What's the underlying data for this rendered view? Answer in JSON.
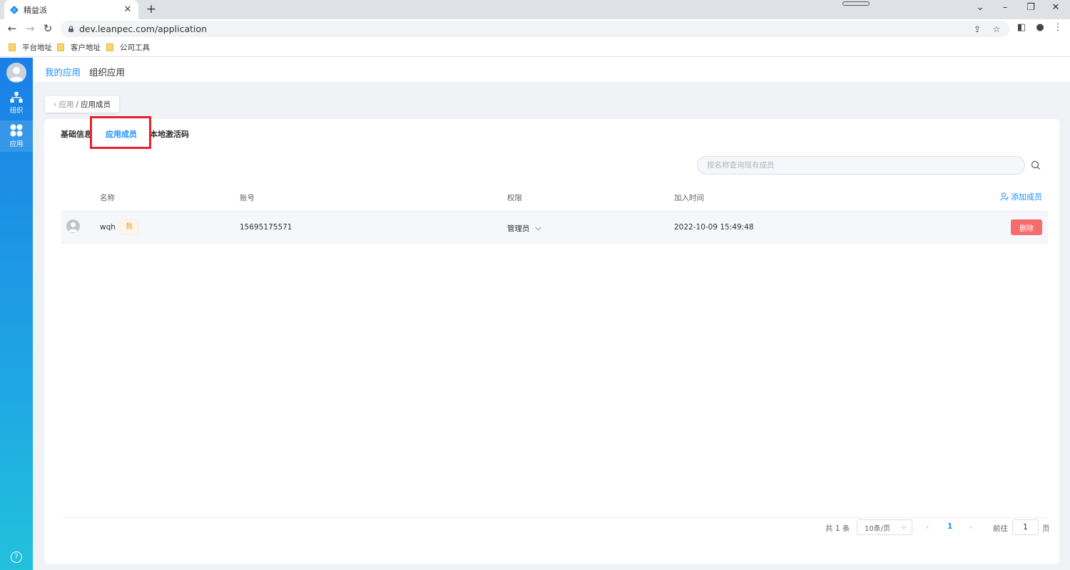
{
  "browser": {
    "tab_title": "精益派",
    "url": "dev.leanpec.com/application",
    "bookmarks": [
      "平台地址",
      "客户地址",
      "公司工具"
    ]
  },
  "sidebar": {
    "items": [
      {
        "label": "组织",
        "icon": "org-chart-icon"
      },
      {
        "label": "应用",
        "icon": "apps-grid-icon"
      }
    ],
    "help_glyph": "?"
  },
  "header": {
    "tabs": [
      {
        "label": "我的应用",
        "active": true
      },
      {
        "label": "组织应用",
        "active": false
      }
    ]
  },
  "breadcrumb": {
    "back": "应用",
    "separator": "/",
    "current": "应用成员"
  },
  "sub_tabs": [
    "基础信息",
    "应用成员",
    "本地激活码"
  ],
  "search": {
    "placeholder": "按名称查询现有成员",
    "value": ""
  },
  "table": {
    "columns": [
      "名称",
      "账号",
      "权限",
      "加入时间"
    ],
    "add_label": "添加成员",
    "rows": [
      {
        "name": "wqh",
        "badge": "我",
        "account": "15695175571",
        "role": "管理员",
        "joined": "2022-10-09 15:49:48",
        "action": "删除"
      }
    ]
  },
  "pagination": {
    "total": "共 1 条",
    "page_size": "10条/页",
    "current_page": "1",
    "goto_label": "前往",
    "goto_value": "1",
    "page_suffix": "页"
  },
  "colors": {
    "accent": "#1890ff",
    "danger": "#f56c6c",
    "highlight": "#e8212a",
    "rail_top": "#1a7fe6",
    "rail_bottom": "#22c1dc"
  }
}
